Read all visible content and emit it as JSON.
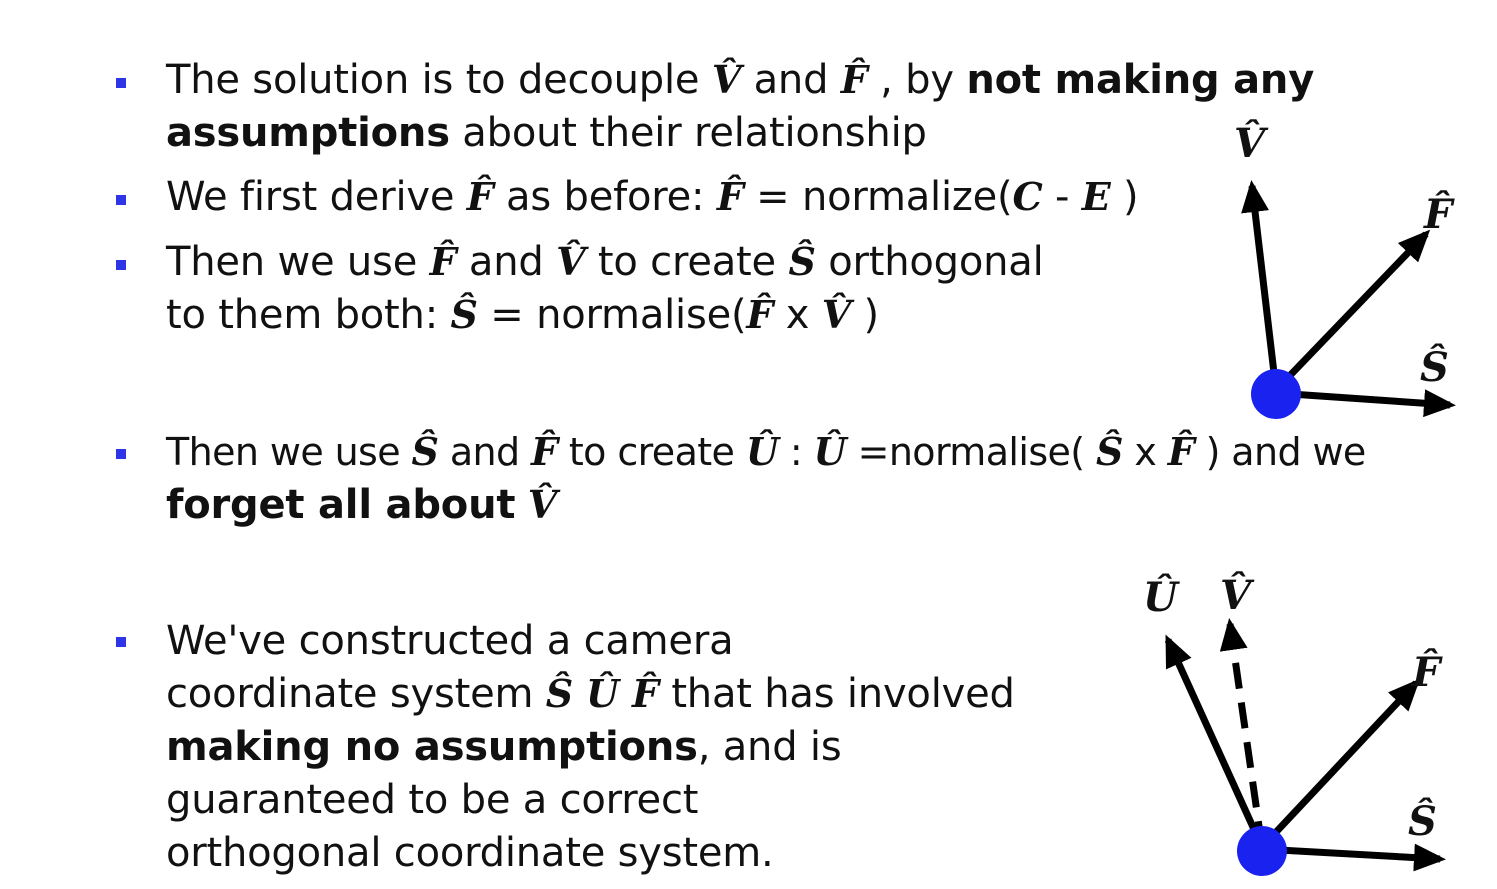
{
  "bullets": [
    {
      "lines": [
        [
          "The solution is to decouple ",
          "V̂",
          " and ",
          "F̂",
          " , by ",
          "not making any"
        ],
        [
          "assumptions",
          " about their relationship"
        ]
      ]
    },
    {
      "lines": [
        [
          "We first derive ",
          "F̂",
          " as before: ",
          "F̂",
          " = normalize(",
          "C",
          " - ",
          "E",
          " )"
        ]
      ]
    },
    {
      "lines": [
        [
          "Then we use ",
          "F̂",
          " and ",
          "V̂",
          " to create ",
          "Ŝ",
          " orthogonal"
        ],
        [
          "to them both: ",
          "Ŝ",
          " = normalise(",
          "F̂",
          " x ",
          "V̂",
          " )"
        ]
      ]
    },
    {
      "lines": [
        [
          "Then we use ",
          "Ŝ",
          " and ",
          "F̂",
          " to create ",
          "Û",
          " : ",
          "Û",
          " =normalise( ",
          "Ŝ",
          " x ",
          "F̂",
          " ) and we"
        ],
        [
          "forget all about",
          " ",
          "V̂"
        ]
      ]
    },
    {
      "lines": [
        [
          "We've constructed a camera"
        ],
        [
          "coordinate system ",
          "Ŝ Û F̂",
          "  that has involved"
        ],
        [
          "making no assumptions",
          ", and is"
        ],
        [
          "guaranteed to be a correct"
        ],
        [
          "orthogonal coordinate system."
        ]
      ]
    }
  ],
  "diagram1": {
    "labels": {
      "v": "V̂",
      "f": "F̂",
      "s": "Ŝ"
    }
  },
  "diagram2": {
    "labels": {
      "u": "Û",
      "v": "V̂",
      "f": "F̂",
      "s": "Ŝ"
    }
  },
  "colors": {
    "bullet": "#2d35e6",
    "origin": "#1a22f0",
    "arrow": "#000000"
  }
}
